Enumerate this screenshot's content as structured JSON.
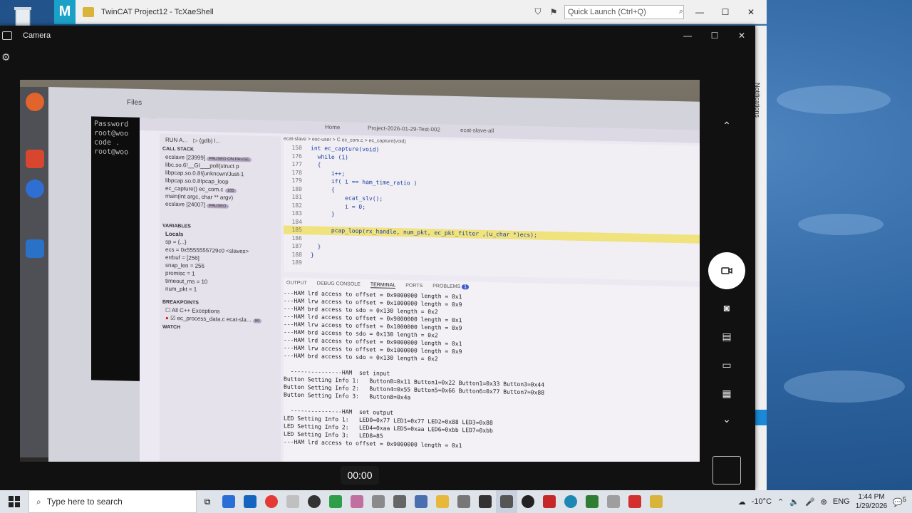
{
  "twincat": {
    "title": "TwinCAT Project12 - TcXaeShell",
    "logo": "M",
    "quick_launch": "Quick Launch (Ctrl+Q)"
  },
  "camera": {
    "title": "Camera",
    "timer": "00:00"
  },
  "side_text": "Notifications",
  "screen": {
    "files_title": "Files",
    "terminal_lines": [
      "Password",
      "root@woo",
      "code .",
      "root@woo"
    ],
    "debug": {
      "run_label": "RUN A...",
      "config": "(gdb) l...",
      "call_stack_header": "CALL STACK",
      "frames": [
        {
          "label": "ecslave [23999]",
          "badge": "PAUSED ON PAUSE"
        },
        {
          "label": "libc.so.6!__GI___poll(struct p",
          "badge": ""
        },
        {
          "label": "libpcap.so.0.8!{unknown/Just-1",
          "badge": ""
        },
        {
          "label": "libpcap.so.0.8!pcap_loop",
          "badge": ""
        },
        {
          "label": "ec_capture()   ec_com.c",
          "badge": "185"
        },
        {
          "label": "main(int argc, char ** argv)",
          "badge": ""
        },
        {
          "label": "ecslave [24007]",
          "badge": "PAUSED"
        }
      ],
      "variables_header": "VARIABLES",
      "locals_header": "Locals",
      "variables": [
        "sp = {...}",
        "ecs = 0x5555555729c0 <slaves>",
        "errbuf = [256]",
        "snap_len = 256",
        "promisc = 1",
        "timeout_ms = 10",
        "num_pkt = 1"
      ],
      "breakpoints_header": "BREAKPOINTS",
      "breakpoints": [
        "All C++ Exceptions",
        "ec_process_data.c   ecat-sla..."
      ],
      "breakpoint_badge": "80",
      "watch_header": "WATCH"
    },
    "breadcrumb": "ecat-slave > esc-user > C ec_com.c > ec_capture(void)",
    "top_bar": [
      "Home",
      "Project-2026-01-29-Test-002",
      "ecat-slave-all"
    ],
    "code": [
      {
        "n": "150",
        "t": "int ec_capture(void)"
      },
      {
        "n": "176",
        "t": "  while (1)"
      },
      {
        "n": "177",
        "t": "  {"
      },
      {
        "n": "178",
        "t": "      i++;"
      },
      {
        "n": "179",
        "t": "      if( i == ham_time_ratio )"
      },
      {
        "n": "180",
        "t": "      {"
      },
      {
        "n": "181",
        "t": "          ecat_slv();"
      },
      {
        "n": "182",
        "t": "          i = 0;"
      },
      {
        "n": "183",
        "t": "      }"
      },
      {
        "n": "184",
        "t": ""
      },
      {
        "n": "185",
        "t": "      pcap_loop(rx_handle, num_pkt, ec_pkt_filter ,(u_char *)ecs);"
      },
      {
        "n": "186",
        "t": ""
      },
      {
        "n": "187",
        "t": "  }"
      },
      {
        "n": "188",
        "t": "}"
      },
      {
        "n": "189",
        "t": ""
      }
    ],
    "panel_tabs": [
      "OUTPUT",
      "DEBUG CONSOLE",
      "TERMINAL",
      "PORTS",
      "PROBLEMS"
    ],
    "problems_count": "1",
    "terminal_output": [
      "---HAM lrd access to offset = 0x9000000 length = 0x1",
      "---HAM lrw access to offset = 0x1000000 length = 0x9",
      "---HAM brd access to sdo = 0x130 length = 0x2",
      "---HAM lrd access to offset = 0x9000000 length = 0x1",
      "---HAM lrw access to offset = 0x1000000 length = 0x9",
      "---HAM brd access to sdo = 0x130 length = 0x2",
      "---HAM lrd access to offset = 0x9000000 length = 0x1",
      "---HAM lrw access to offset = 0x1000000 length = 0x9",
      "---HAM brd access to sdo = 0x130 length = 0x2",
      "",
      "  ---------------HAM  set input",
      "Button Setting Info 1:   Button0=0x11 Button1=0x22 Button1=0x33 Button3=0x44",
      "Button Setting Info 2:   Button4=0x55 Button5=0x66 Button6=0x77 Button7=0x88",
      "Button Setting Info 3:   Button8=0x4a",
      "",
      "  ---------------HAM  set output",
      "LED Setting Info 1:   LED0=0x77 LED1=0x77 LED2=0x88 LED3=0x88",
      "LED Setting Info 2:   LED4=0xaa LED5=0xaa LED6=0xbb LED7=0xbb",
      "LED Setting Info 3:   LED8=85",
      "---HAM lrd access to offset = 0x9000000 length = 0x1"
    ]
  },
  "taskbar": {
    "search_placeholder": "Type here to search",
    "weather": "-10°C",
    "language": "ENG",
    "time": "1:44 PM",
    "date": "1/29/2026",
    "notification_count": "5"
  }
}
